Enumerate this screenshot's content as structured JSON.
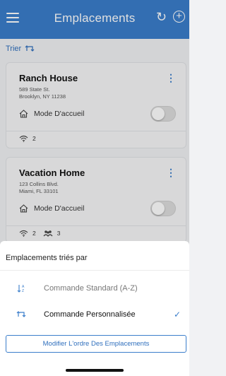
{
  "header": {
    "title": "Emplacements",
    "menu_icon": "hamburger-menu-icon",
    "refresh_icon": "refresh-icon",
    "add_icon": "add-circle-icon",
    "color": "#3b7ecb"
  },
  "sort": {
    "label": "Trier",
    "icon": "reorder-arrows-icon"
  },
  "locations": [
    {
      "name": "Ranch House",
      "address_line1": "589 State St.",
      "address_line2": "Brooklyn, NY 11238",
      "mode_label": "Mode D'accueil",
      "mode_on": false,
      "wifi_count": "2",
      "people_count": ""
    },
    {
      "name": "Vacation Home",
      "address_line1": "123 Collins Blvd.",
      "address_line2": "Miami, FL 33101",
      "mode_label": "Mode D'accueil",
      "mode_on": false,
      "wifi_count": "2",
      "people_count": "3"
    }
  ],
  "sheet": {
    "title": "Emplacements triés par",
    "options": [
      {
        "label": "Commande Standard (A-Z)",
        "icon": "sort-alpha-icon",
        "selected": false,
        "text_color": "#777777"
      },
      {
        "label": "Commande Personnalisée",
        "icon": "reorder-arrows-icon",
        "selected": true,
        "text_color": "#111111"
      }
    ],
    "edit_button": "Modifier L'ordre Des Emplacements"
  }
}
